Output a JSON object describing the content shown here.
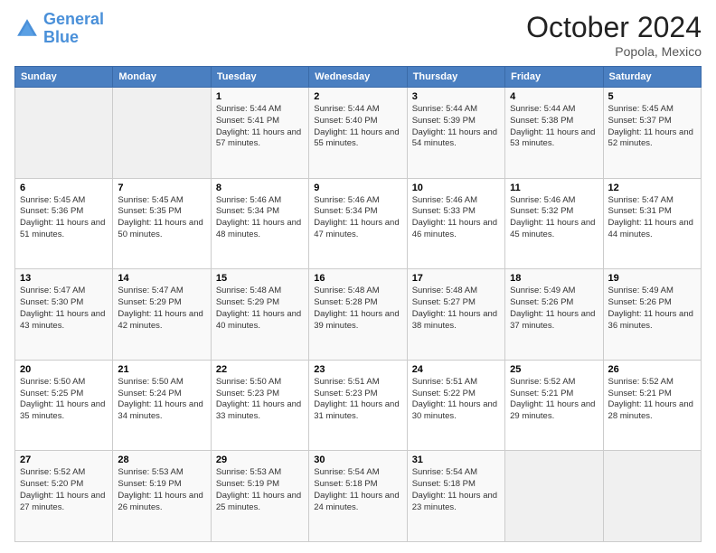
{
  "header": {
    "logo_line1": "General",
    "logo_line2": "Blue",
    "month_title": "October 2024",
    "location": "Popola, Mexico"
  },
  "weekdays": [
    "Sunday",
    "Monday",
    "Tuesday",
    "Wednesday",
    "Thursday",
    "Friday",
    "Saturday"
  ],
  "weeks": [
    [
      {
        "day": "",
        "sunrise": "",
        "sunset": "",
        "daylight": ""
      },
      {
        "day": "",
        "sunrise": "",
        "sunset": "",
        "daylight": ""
      },
      {
        "day": "1",
        "sunrise": "Sunrise: 5:44 AM",
        "sunset": "Sunset: 5:41 PM",
        "daylight": "Daylight: 11 hours and 57 minutes."
      },
      {
        "day": "2",
        "sunrise": "Sunrise: 5:44 AM",
        "sunset": "Sunset: 5:40 PM",
        "daylight": "Daylight: 11 hours and 55 minutes."
      },
      {
        "day": "3",
        "sunrise": "Sunrise: 5:44 AM",
        "sunset": "Sunset: 5:39 PM",
        "daylight": "Daylight: 11 hours and 54 minutes."
      },
      {
        "day": "4",
        "sunrise": "Sunrise: 5:44 AM",
        "sunset": "Sunset: 5:38 PM",
        "daylight": "Daylight: 11 hours and 53 minutes."
      },
      {
        "day": "5",
        "sunrise": "Sunrise: 5:45 AM",
        "sunset": "Sunset: 5:37 PM",
        "daylight": "Daylight: 11 hours and 52 minutes."
      }
    ],
    [
      {
        "day": "6",
        "sunrise": "Sunrise: 5:45 AM",
        "sunset": "Sunset: 5:36 PM",
        "daylight": "Daylight: 11 hours and 51 minutes."
      },
      {
        "day": "7",
        "sunrise": "Sunrise: 5:45 AM",
        "sunset": "Sunset: 5:35 PM",
        "daylight": "Daylight: 11 hours and 50 minutes."
      },
      {
        "day": "8",
        "sunrise": "Sunrise: 5:46 AM",
        "sunset": "Sunset: 5:34 PM",
        "daylight": "Daylight: 11 hours and 48 minutes."
      },
      {
        "day": "9",
        "sunrise": "Sunrise: 5:46 AM",
        "sunset": "Sunset: 5:34 PM",
        "daylight": "Daylight: 11 hours and 47 minutes."
      },
      {
        "day": "10",
        "sunrise": "Sunrise: 5:46 AM",
        "sunset": "Sunset: 5:33 PM",
        "daylight": "Daylight: 11 hours and 46 minutes."
      },
      {
        "day": "11",
        "sunrise": "Sunrise: 5:46 AM",
        "sunset": "Sunset: 5:32 PM",
        "daylight": "Daylight: 11 hours and 45 minutes."
      },
      {
        "day": "12",
        "sunrise": "Sunrise: 5:47 AM",
        "sunset": "Sunset: 5:31 PM",
        "daylight": "Daylight: 11 hours and 44 minutes."
      }
    ],
    [
      {
        "day": "13",
        "sunrise": "Sunrise: 5:47 AM",
        "sunset": "Sunset: 5:30 PM",
        "daylight": "Daylight: 11 hours and 43 minutes."
      },
      {
        "day": "14",
        "sunrise": "Sunrise: 5:47 AM",
        "sunset": "Sunset: 5:29 PM",
        "daylight": "Daylight: 11 hours and 42 minutes."
      },
      {
        "day": "15",
        "sunrise": "Sunrise: 5:48 AM",
        "sunset": "Sunset: 5:29 PM",
        "daylight": "Daylight: 11 hours and 40 minutes."
      },
      {
        "day": "16",
        "sunrise": "Sunrise: 5:48 AM",
        "sunset": "Sunset: 5:28 PM",
        "daylight": "Daylight: 11 hours and 39 minutes."
      },
      {
        "day": "17",
        "sunrise": "Sunrise: 5:48 AM",
        "sunset": "Sunset: 5:27 PM",
        "daylight": "Daylight: 11 hours and 38 minutes."
      },
      {
        "day": "18",
        "sunrise": "Sunrise: 5:49 AM",
        "sunset": "Sunset: 5:26 PM",
        "daylight": "Daylight: 11 hours and 37 minutes."
      },
      {
        "day": "19",
        "sunrise": "Sunrise: 5:49 AM",
        "sunset": "Sunset: 5:26 PM",
        "daylight": "Daylight: 11 hours and 36 minutes."
      }
    ],
    [
      {
        "day": "20",
        "sunrise": "Sunrise: 5:50 AM",
        "sunset": "Sunset: 5:25 PM",
        "daylight": "Daylight: 11 hours and 35 minutes."
      },
      {
        "day": "21",
        "sunrise": "Sunrise: 5:50 AM",
        "sunset": "Sunset: 5:24 PM",
        "daylight": "Daylight: 11 hours and 34 minutes."
      },
      {
        "day": "22",
        "sunrise": "Sunrise: 5:50 AM",
        "sunset": "Sunset: 5:23 PM",
        "daylight": "Daylight: 11 hours and 33 minutes."
      },
      {
        "day": "23",
        "sunrise": "Sunrise: 5:51 AM",
        "sunset": "Sunset: 5:23 PM",
        "daylight": "Daylight: 11 hours and 31 minutes."
      },
      {
        "day": "24",
        "sunrise": "Sunrise: 5:51 AM",
        "sunset": "Sunset: 5:22 PM",
        "daylight": "Daylight: 11 hours and 30 minutes."
      },
      {
        "day": "25",
        "sunrise": "Sunrise: 5:52 AM",
        "sunset": "Sunset: 5:21 PM",
        "daylight": "Daylight: 11 hours and 29 minutes."
      },
      {
        "day": "26",
        "sunrise": "Sunrise: 5:52 AM",
        "sunset": "Sunset: 5:21 PM",
        "daylight": "Daylight: 11 hours and 28 minutes."
      }
    ],
    [
      {
        "day": "27",
        "sunrise": "Sunrise: 5:52 AM",
        "sunset": "Sunset: 5:20 PM",
        "daylight": "Daylight: 11 hours and 27 minutes."
      },
      {
        "day": "28",
        "sunrise": "Sunrise: 5:53 AM",
        "sunset": "Sunset: 5:19 PM",
        "daylight": "Daylight: 11 hours and 26 minutes."
      },
      {
        "day": "29",
        "sunrise": "Sunrise: 5:53 AM",
        "sunset": "Sunset: 5:19 PM",
        "daylight": "Daylight: 11 hours and 25 minutes."
      },
      {
        "day": "30",
        "sunrise": "Sunrise: 5:54 AM",
        "sunset": "Sunset: 5:18 PM",
        "daylight": "Daylight: 11 hours and 24 minutes."
      },
      {
        "day": "31",
        "sunrise": "Sunrise: 5:54 AM",
        "sunset": "Sunset: 5:18 PM",
        "daylight": "Daylight: 11 hours and 23 minutes."
      },
      {
        "day": "",
        "sunrise": "",
        "sunset": "",
        "daylight": ""
      },
      {
        "day": "",
        "sunrise": "",
        "sunset": "",
        "daylight": ""
      }
    ]
  ]
}
